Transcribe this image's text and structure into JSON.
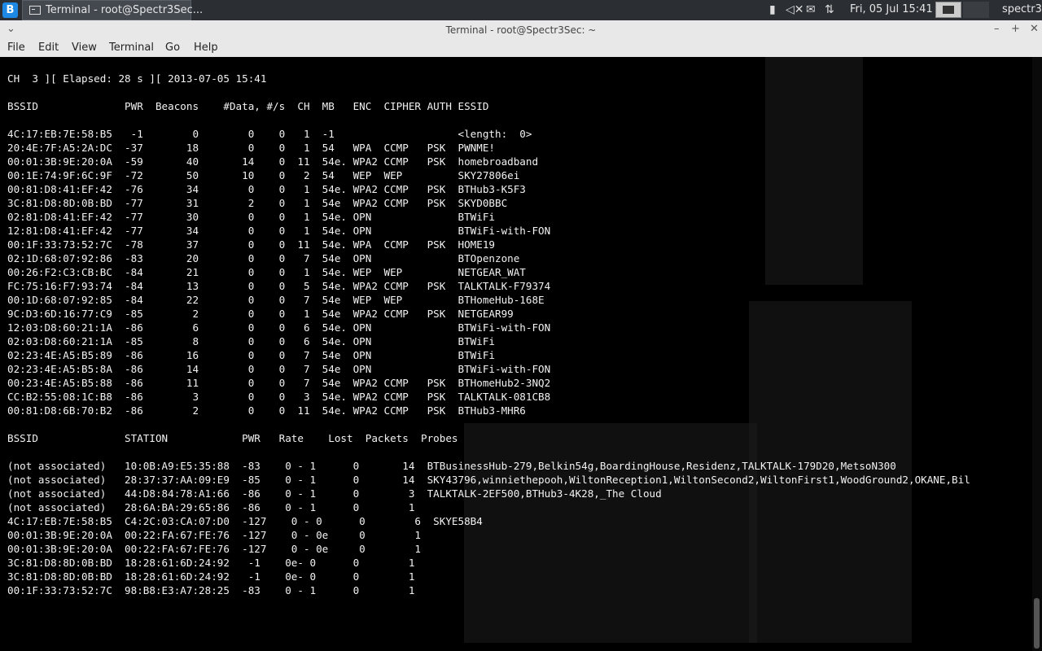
{
  "panel": {
    "menu_glyph": "B",
    "task_label": "Terminal - root@Spectr3Sec...",
    "clock": "Fri, 05 Jul  15:41",
    "user": "spectr3",
    "tray_icons": [
      "battery-icon",
      "volume-icon",
      "mail-icon",
      "network-icon"
    ]
  },
  "window": {
    "title": "Terminal - root@Spectr3Sec: ~",
    "menus": [
      "File",
      "Edit",
      "View",
      "Terminal",
      "Go",
      "Help"
    ]
  },
  "terminal": {
    "header": "CH  3 ][ Elapsed: 28 s ][ 2013-07-05 15:41",
    "ap_header": "BSSID              PWR  Beacons    #Data, #/s  CH  MB   ENC  CIPHER AUTH ESSID",
    "ap_rows": [
      "4C:17:EB:7E:58:B5   -1        0        0    0   1  -1                    <length:  0>",
      "20:4E:7F:A5:2A:DC  -37       18        0    0   1  54   WPA  CCMP   PSK  PWNME!",
      "00:01:3B:9E:20:0A  -59       40       14    0  11  54e. WPA2 CCMP   PSK  homebroadband",
      "00:1E:74:9F:6C:9F  -72       50       10    0   2  54   WEP  WEP         SKY27806ei",
      "00:81:D8:41:EF:42  -76       34        0    0   1  54e. WPA2 CCMP   PSK  BTHub3-K5F3",
      "3C:81:D8:8D:0B:BD  -77       31        2    0   1  54e  WPA2 CCMP   PSK  SKYD0BBC",
      "02:81:D8:41:EF:42  -77       30        0    0   1  54e. OPN              BTWiFi",
      "12:81:D8:41:EF:42  -77       34        0    0   1  54e. OPN              BTWiFi-with-FON",
      "00:1F:33:73:52:7C  -78       37        0    0  11  54e. WPA  CCMP   PSK  HOME19",
      "02:1D:68:07:92:86  -83       20        0    0   7  54e  OPN              BTOpenzone",
      "00:26:F2:C3:CB:BC  -84       21        0    0   1  54e. WEP  WEP         NETGEAR_WAT",
      "FC:75:16:F7:93:74  -84       13        0    0   5  54e. WPA2 CCMP   PSK  TALKTALK-F79374",
      "00:1D:68:07:92:85  -84       22        0    0   7  54e  WEP  WEP         BTHomeHub-168E",
      "9C:D3:6D:16:77:C9  -85        2        0    0   1  54e  WPA2 CCMP   PSK  NETGEAR99",
      "12:03:D8:60:21:1A  -86        6        0    0   6  54e. OPN              BTWiFi-with-FON",
      "02:03:D8:60:21:1A  -85        8        0    0   6  54e. OPN              BTWiFi",
      "02:23:4E:A5:B5:89  -86       16        0    0   7  54e  OPN              BTWiFi",
      "02:23:4E:A5:B5:8A  -86       14        0    0   7  54e  OPN              BTWiFi-with-FON",
      "00:23:4E:A5:B5:88  -86       11        0    0   7  54e  WPA2 CCMP   PSK  BTHomeHub2-3NQ2",
      "CC:B2:55:08:1C:B8  -86        3        0    0   3  54e. WPA2 CCMP   PSK  TALKTALK-081CB8",
      "00:81:D8:6B:70:B2  -86        2        0    0  11  54e. WPA2 CCMP   PSK  BTHub3-MHR6"
    ],
    "sta_header": "BSSID              STATION            PWR   Rate    Lost  Packets  Probes",
    "sta_rows": [
      "(not associated)   10:0B:A9:E5:35:88  -83    0 - 1      0       14  BTBusinessHub-279,Belkin54g,BoardingHouse,Residenz,TALKTALK-179D20,MetsoN300",
      "(not associated)   28:37:37:AA:09:E9  -85    0 - 1      0       14  SKY43796,winniethepooh,WiltonReception1,WiltonSecond2,WiltonFirst1,WoodGround2,OKANE,Bil",
      "(not associated)   44:D8:84:78:A1:66  -86    0 - 1      0        3  TALKTALK-2EF500,BTHub3-4K28,_The Cloud",
      "(not associated)   28:6A:BA:29:65:86  -86    0 - 1      0        1",
      "4C:17:EB:7E:58:B5  C4:2C:03:CA:07:D0  -127    0 - 0      0        6  SKYE58B4",
      "00:01:3B:9E:20:0A  00:22:FA:67:FE:76  -127    0 - 0e     0        1",
      "00:01:3B:9E:20:0A  00:22:FA:67:FE:76  -127    0 - 0e     0        1",
      "3C:81:D8:8D:0B:BD  18:28:61:6D:24:92   -1    0e- 0      0        1",
      "3C:81:D8:8D:0B:BD  18:28:61:6D:24:92   -1    0e- 0      0        1",
      "00:1F:33:73:52:7C  98:B8:E3:A7:28:25  -83    0 - 1      0        1"
    ]
  }
}
